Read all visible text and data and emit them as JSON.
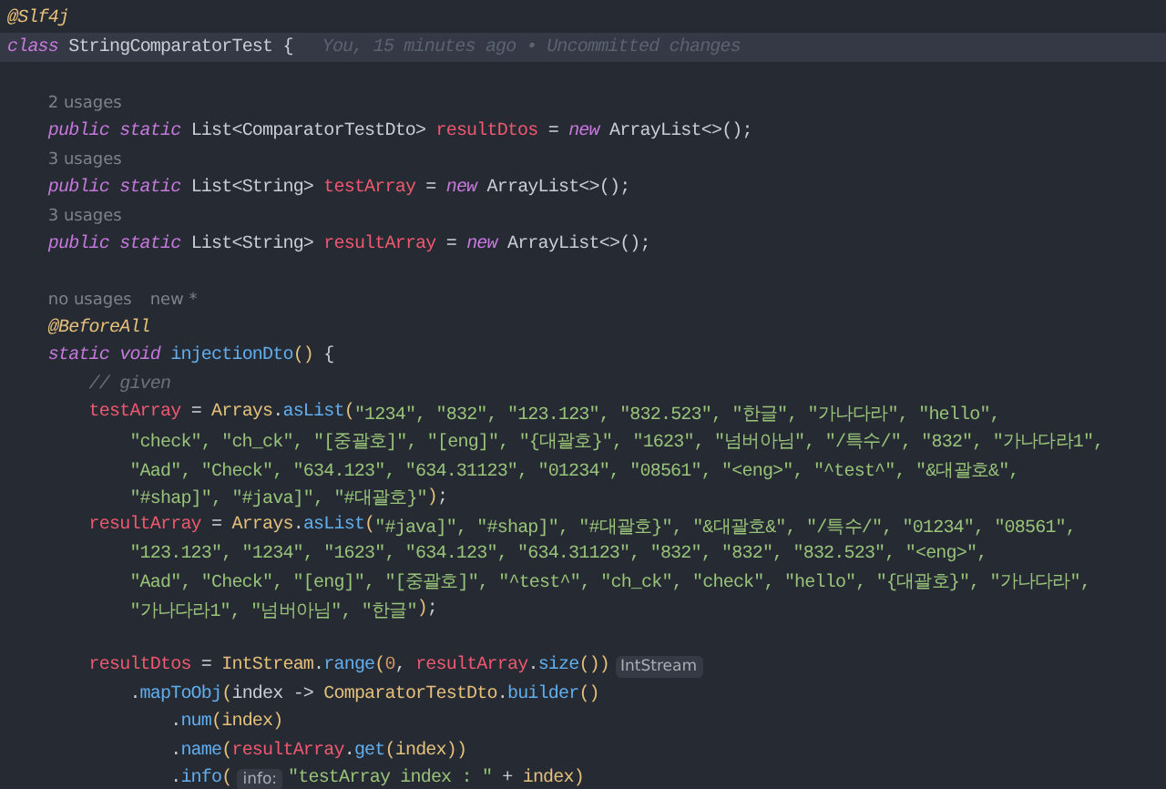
{
  "editor": {
    "lines": [
      {
        "kind": "code",
        "tokens": [
          {
            "kind": "annotation",
            "text": "@Slf4j"
          }
        ]
      },
      {
        "kind": "code",
        "current": true,
        "tokens": [
          {
            "kind": "keyword",
            "text": "class"
          },
          {
            "kind": "plain",
            "text": " StringComparatorTest {"
          },
          {
            "kind": "blame",
            "text": "You, 15 minutes ago • Uncommitted changes"
          }
        ]
      },
      {
        "kind": "blank"
      },
      {
        "kind": "hint",
        "tokens": [
          {
            "kind": "hint",
            "text": "    2 usages"
          }
        ]
      },
      {
        "kind": "code",
        "tokens": [
          {
            "kind": "keyword",
            "text": "    public static"
          },
          {
            "kind": "plain",
            "text": " List<ComparatorTestDto> "
          },
          {
            "kind": "field",
            "text": "resultDtos"
          },
          {
            "kind": "plain",
            "text": " = "
          },
          {
            "kind": "keyword",
            "text": "new"
          },
          {
            "kind": "plain",
            "text": " ArrayList<>();"
          }
        ]
      },
      {
        "kind": "hint",
        "tokens": [
          {
            "kind": "hint",
            "text": "    3 usages"
          }
        ]
      },
      {
        "kind": "code",
        "tokens": [
          {
            "kind": "keyword",
            "text": "    public static"
          },
          {
            "kind": "plain",
            "text": " List<String> "
          },
          {
            "kind": "field",
            "text": "testArray"
          },
          {
            "kind": "plain",
            "text": " = "
          },
          {
            "kind": "keyword",
            "text": "new"
          },
          {
            "kind": "plain",
            "text": " ArrayList<>();"
          }
        ]
      },
      {
        "kind": "hint",
        "tokens": [
          {
            "kind": "hint",
            "text": "    3 usages"
          }
        ]
      },
      {
        "kind": "code",
        "tokens": [
          {
            "kind": "keyword",
            "text": "    public static"
          },
          {
            "kind": "plain",
            "text": " List<String> "
          },
          {
            "kind": "field",
            "text": "resultArray"
          },
          {
            "kind": "plain",
            "text": " = "
          },
          {
            "kind": "keyword",
            "text": "new"
          },
          {
            "kind": "plain",
            "text": " ArrayList<>();"
          }
        ]
      },
      {
        "kind": "blank"
      },
      {
        "kind": "hint",
        "tokens": [
          {
            "kind": "hint",
            "text": "    no usages"
          },
          {
            "kind": "hint",
            "text": "new *"
          }
        ]
      },
      {
        "kind": "code",
        "tokens": [
          {
            "kind": "annotation",
            "text": "    @BeforeAll"
          }
        ]
      },
      {
        "kind": "code",
        "tokens": [
          {
            "kind": "keyword",
            "text": "    static void"
          },
          {
            "kind": "method",
            "text": " injectionDto"
          },
          {
            "kind": "paren",
            "text": "()"
          },
          {
            "kind": "plain",
            "text": " {"
          }
        ]
      },
      {
        "kind": "code",
        "tokens": [
          {
            "kind": "comment",
            "text": "        // given"
          }
        ]
      },
      {
        "kind": "code",
        "tokens": [
          {
            "kind": "field",
            "text": "        testArray"
          },
          {
            "kind": "plain",
            "text": " = "
          },
          {
            "kind": "class",
            "text": "Arrays"
          },
          {
            "kind": "plain",
            "text": "."
          },
          {
            "kind": "method",
            "text": "asList"
          },
          {
            "kind": "paren",
            "text": "("
          },
          {
            "kind": "string",
            "text": "\"1234\", \"832\", \"123.123\", \"832.523\", \"한글\", \"가나다라\", \"hello\","
          }
        ]
      },
      {
        "kind": "code",
        "tokens": [
          {
            "kind": "string",
            "text": "            \"check\", \"ch_ck\", \"[중괄호]\", \"[eng]\", \"{대괄호}\", \"1623\", \"넘버아님\", \"/특수/\", \"832\", \"가나다라1\","
          }
        ]
      },
      {
        "kind": "code",
        "tokens": [
          {
            "kind": "string",
            "text": "            \"Aad\", \"Check\", \"634.123\", \"634.31123\", \"01234\", \"08561\", \"<eng>\", \"^test^\", \"&대괄호&\","
          }
        ]
      },
      {
        "kind": "code",
        "tokens": [
          {
            "kind": "string",
            "text": "            \"#shap]\", \"#java]\", \"#대괄호}\""
          },
          {
            "kind": "paren",
            "text": ")"
          },
          {
            "kind": "plain",
            "text": ";"
          }
        ]
      },
      {
        "kind": "code",
        "tokens": [
          {
            "kind": "field",
            "text": "        resultArray"
          },
          {
            "kind": "plain",
            "text": " = "
          },
          {
            "kind": "class",
            "text": "Arrays"
          },
          {
            "kind": "plain",
            "text": "."
          },
          {
            "kind": "method",
            "text": "asList"
          },
          {
            "kind": "paren",
            "text": "("
          },
          {
            "kind": "string",
            "text": "\"#java]\", \"#shap]\", \"#대괄호}\", \"&대괄호&\", \"/특수/\", \"01234\", \"08561\","
          }
        ]
      },
      {
        "kind": "code",
        "tokens": [
          {
            "kind": "string",
            "text": "            \"123.123\", \"1234\", \"1623\", \"634.123\", \"634.31123\", \"832\", \"832\", \"832.523\", \"<eng>\","
          }
        ]
      },
      {
        "kind": "code",
        "tokens": [
          {
            "kind": "string",
            "text": "            \"Aad\", \"Check\", \"[eng]\", \"[중괄호]\", \"^test^\", \"ch_ck\", \"check\", \"hello\", \"{대괄호}\", \"가나다라\","
          }
        ]
      },
      {
        "kind": "code",
        "tokens": [
          {
            "kind": "string",
            "text": "            \"가나다라1\", \"넘버아님\", \"한글\""
          },
          {
            "kind": "paren",
            "text": ")"
          },
          {
            "kind": "plain",
            "text": ";"
          }
        ]
      },
      {
        "kind": "blank"
      },
      {
        "kind": "code",
        "tokens": [
          {
            "kind": "field",
            "text": "        resultDtos"
          },
          {
            "kind": "plain",
            "text": " = "
          },
          {
            "kind": "class",
            "text": "IntStream"
          },
          {
            "kind": "plain",
            "text": "."
          },
          {
            "kind": "method",
            "text": "range"
          },
          {
            "kind": "paren",
            "text": "("
          },
          {
            "kind": "number",
            "text": "0"
          },
          {
            "kind": "plain",
            "text": ", "
          },
          {
            "kind": "field",
            "text": "resultArray"
          },
          {
            "kind": "plain",
            "text": "."
          },
          {
            "kind": "method",
            "text": "size"
          },
          {
            "kind": "paren",
            "text": "())"
          },
          {
            "kind": "inlay",
            "text": "IntStream"
          }
        ]
      },
      {
        "kind": "code",
        "tokens": [
          {
            "kind": "plain",
            "text": "            ."
          },
          {
            "kind": "method",
            "text": "mapToObj"
          },
          {
            "kind": "paren",
            "text": "("
          },
          {
            "kind": "plain",
            "text": "index -> "
          },
          {
            "kind": "class",
            "text": "ComparatorTestDto"
          },
          {
            "kind": "plain",
            "text": "."
          },
          {
            "kind": "method",
            "text": "builder"
          },
          {
            "kind": "paren",
            "text": "()"
          }
        ]
      },
      {
        "kind": "code",
        "tokens": [
          {
            "kind": "plain",
            "text": "                ."
          },
          {
            "kind": "method",
            "text": "num"
          },
          {
            "kind": "paren",
            "text": "("
          },
          {
            "kind": "param",
            "text": "index"
          },
          {
            "kind": "paren",
            "text": ")"
          }
        ]
      },
      {
        "kind": "code",
        "tokens": [
          {
            "kind": "plain",
            "text": "                ."
          },
          {
            "kind": "method",
            "text": "name"
          },
          {
            "kind": "paren",
            "text": "("
          },
          {
            "kind": "field",
            "text": "resultArray"
          },
          {
            "kind": "plain",
            "text": "."
          },
          {
            "kind": "method",
            "text": "get"
          },
          {
            "kind": "paren",
            "text": "("
          },
          {
            "kind": "param",
            "text": "index"
          },
          {
            "kind": "paren",
            "text": "))"
          }
        ]
      },
      {
        "kind": "code",
        "tokens": [
          {
            "kind": "plain",
            "text": "                ."
          },
          {
            "kind": "method",
            "text": "info"
          },
          {
            "kind": "paren",
            "text": "("
          },
          {
            "kind": "inlay",
            "text": "info:"
          },
          {
            "kind": "string",
            "text": "\"testArray index : \""
          },
          {
            "kind": "plain",
            "text": " + "
          },
          {
            "kind": "param",
            "text": "index"
          },
          {
            "kind": "paren",
            "text": ")"
          }
        ]
      }
    ]
  }
}
